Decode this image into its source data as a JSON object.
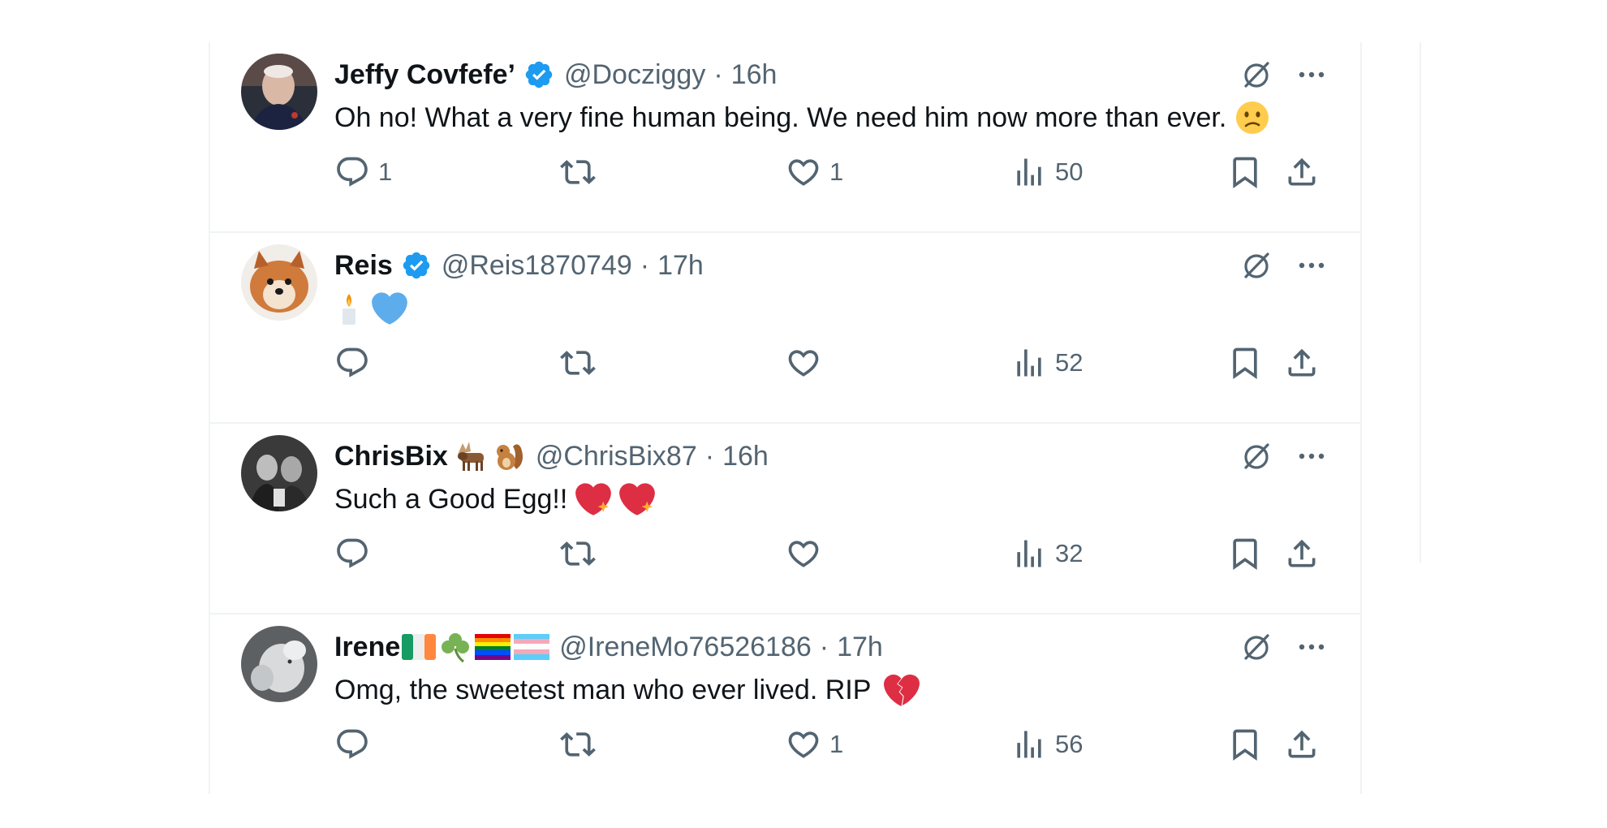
{
  "tweets": [
    {
      "name": "Jeffy Covfefe’",
      "name_emojis": [],
      "verified": true,
      "handle": "@Docziggy",
      "separator": "·",
      "time": "16h",
      "text": "Oh no! What a very fine human being. We need him now more than ever.",
      "text_emojis": [
        "confused-face-emoji"
      ],
      "stats": {
        "replies": "1",
        "reposts": "",
        "likes": "1",
        "views": "50"
      }
    },
    {
      "name": "Reis",
      "name_emojis": [],
      "verified": true,
      "handle": "@Reis1870749",
      "separator": "·",
      "time": "17h",
      "text": "",
      "text_emojis": [
        "candle-emoji",
        "blue-heart-emoji"
      ],
      "stats": {
        "replies": "",
        "reposts": "",
        "likes": "",
        "views": "52"
      }
    },
    {
      "name": "ChrisBix",
      "name_emojis": [
        "moose-emoji",
        "chipmunk-emoji"
      ],
      "verified": false,
      "handle": "@ChrisBix87",
      "separator": "·",
      "time": "16h",
      "text": "Such a Good Egg!!",
      "text_emojis": [
        "sparkling-heart-emoji",
        "sparkling-heart-emoji"
      ],
      "stats": {
        "replies": "",
        "reposts": "",
        "likes": "",
        "views": "32"
      }
    },
    {
      "name": "Irene",
      "name_emojis": [
        "ireland-flag-emoji",
        "shamrock-emoji",
        "rainbow-flag-emoji",
        "transgender-flag-emoji"
      ],
      "verified": false,
      "handle": "@IreneMo76526186",
      "separator": "·",
      "time": "17h",
      "text": "Omg, the sweetest man who ever lived. RIP",
      "text_emojis": [
        "broken-heart-emoji"
      ],
      "stats": {
        "replies": "",
        "reposts": "",
        "likes": "1",
        "views": "56"
      }
    }
  ],
  "colors": {
    "text_primary": "#0f1419",
    "text_secondary": "#536471",
    "verified_blue": "#1d9bf0",
    "divider": "#eff3f4"
  }
}
